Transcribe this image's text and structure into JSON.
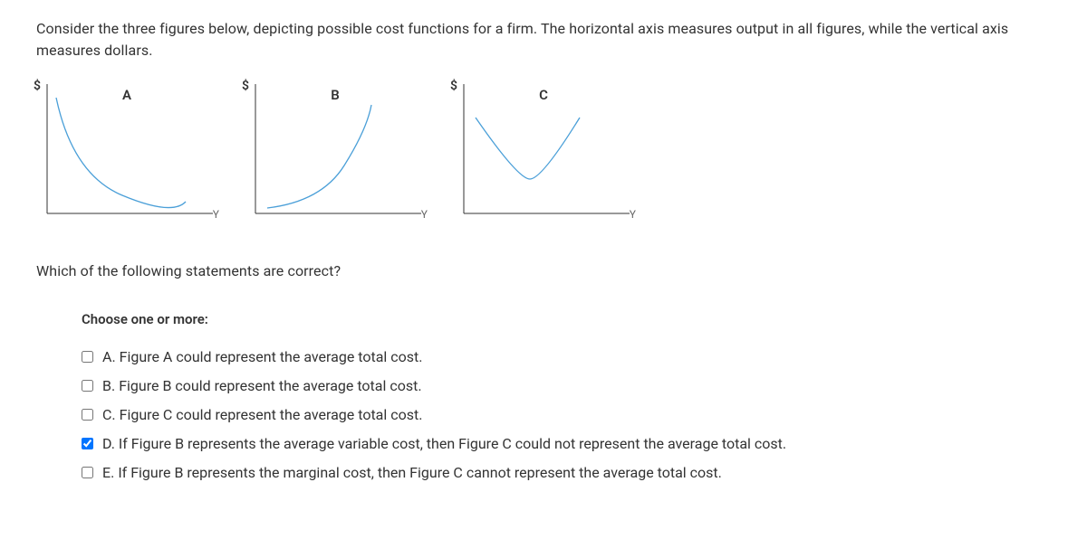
{
  "intro": "Consider the three figures below, depicting possible cost functions for a firm. The horizontal axis measures output in all figures, while the vertical axis measures dollars.",
  "axis": {
    "y": "$",
    "x": "Y"
  },
  "figures": {
    "a": {
      "title": "A"
    },
    "b": {
      "title": "B"
    },
    "c": {
      "title": "C"
    }
  },
  "question": "Which of the following statements are correct?",
  "prompt": "Choose one or more:",
  "options": {
    "a": {
      "letter": "A.",
      "text": "Figure A could represent the average total cost."
    },
    "b": {
      "letter": "B.",
      "text": "Figure B could represent the average total cost."
    },
    "c": {
      "letter": "C.",
      "text": "Figure C could represent the average total cost."
    },
    "d": {
      "letter": "D.",
      "text": "If Figure B represents the average variable cost, then Figure C could not represent the average total cost."
    },
    "e": {
      "letter": "E.",
      "text": "If Figure B represents the marginal cost, then Figure C cannot represent the average total cost."
    }
  },
  "chart_data": [
    {
      "type": "line",
      "title": "A",
      "xlabel": "Y",
      "ylabel": "$",
      "description": "Monotonically decreasing convex curve",
      "x": [
        0,
        0.1,
        0.2,
        0.3,
        0.4,
        0.5,
        0.6,
        0.7,
        0.8
      ],
      "values": [
        1.0,
        0.55,
        0.38,
        0.28,
        0.22,
        0.18,
        0.15,
        0.13,
        0.12
      ]
    },
    {
      "type": "line",
      "title": "B",
      "xlabel": "Y",
      "ylabel": "$",
      "description": "Monotonically increasing convex curve",
      "x": [
        0.05,
        0.15,
        0.25,
        0.35,
        0.45,
        0.55,
        0.65
      ],
      "values": [
        0.04,
        0.06,
        0.1,
        0.18,
        0.32,
        0.55,
        0.9
      ]
    },
    {
      "type": "line",
      "title": "C",
      "xlabel": "Y",
      "ylabel": "$",
      "description": "U-shaped curve",
      "x": [
        0.05,
        0.15,
        0.25,
        0.35,
        0.45,
        0.55,
        0.65
      ],
      "values": [
        0.7,
        0.42,
        0.25,
        0.2,
        0.25,
        0.42,
        0.7
      ]
    }
  ]
}
